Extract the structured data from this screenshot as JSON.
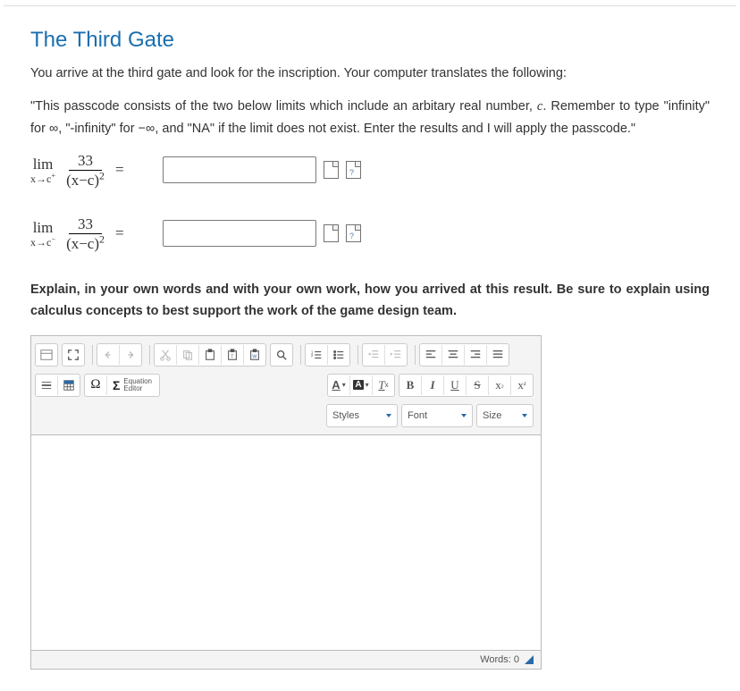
{
  "title": "The Third Gate",
  "intro": "You arrive at the third gate and look for the inscription. Your computer translates the following:",
  "passage": "\"This passcode consists of the two below limits which include an arbitary real number, c. Remember to type \"infinity\" for ∞, \"-infinity\" for −∞, and \"NA\" if the limit does not exist. Enter the results and I will apply the passcode.\"",
  "eq1": {
    "lim_top": "lim",
    "lim_bottom_html": "x→c<span class='sup'>+</span>",
    "numerator": "33",
    "denominator_html": "(x−c)<span class='sup'>2</span>",
    "equals": "="
  },
  "eq2": {
    "lim_top": "lim",
    "lim_bottom_html": "x→c<span class='sup'>−</span>",
    "numerator": "33",
    "denominator_html": "(x−c)<span class='sup'>2</span>",
    "equals": "="
  },
  "explain_prompt": "Explain, in your own words and with your own work, how you arrived at this result. Be sure to explain using calculus concepts to best support the work of the game design team.",
  "editor": {
    "omega": "Ω",
    "eq_label": "Equation Editor",
    "styles": "Styles",
    "font": "Font",
    "size": "Size",
    "words": "Words: 0",
    "A": "A",
    "Tx": "T",
    "B": "B",
    "I": "I",
    "U": "U",
    "S": "S",
    "xsub": "x",
    "xsup": "x"
  }
}
